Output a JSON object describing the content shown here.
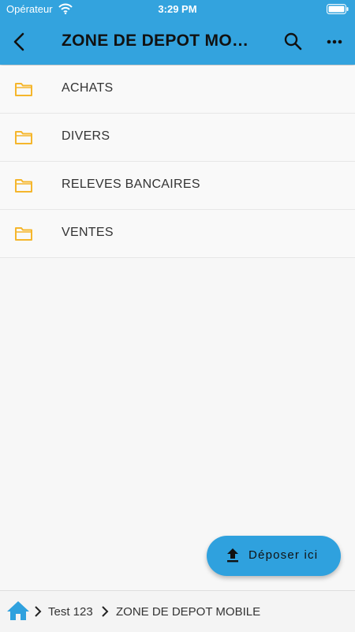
{
  "status_bar": {
    "carrier": "Opérateur",
    "time": "3:29 PM",
    "icons": [
      "wifi-icon",
      "battery-icon"
    ]
  },
  "app_bar": {
    "title": "ZONE DE DEPOT MOBILE",
    "back_icon": "back-arrow-icon",
    "search_icon": "search-icon",
    "more_icon": "more-horizontal-icon"
  },
  "folders": [
    {
      "label": "ACHATS",
      "icon": "folder-icon"
    },
    {
      "label": "DIVERS",
      "icon": "folder-icon"
    },
    {
      "label": "RELEVES BANCAIRES",
      "icon": "folder-icon"
    },
    {
      "label": "VENTES",
      "icon": "folder-icon"
    }
  ],
  "fab": {
    "label": "Déposer ici",
    "icon": "upload-icon"
  },
  "breadcrumb": {
    "home_icon": "home-icon",
    "items": [
      "Test 123",
      "ZONE DE DEPOT MOBILE"
    ]
  },
  "colors": {
    "header_bg": "#33a3de",
    "fab_bg": "#2fa1de",
    "folder_icon": "#f5b62c",
    "page_bg": "#f7f7f7"
  }
}
